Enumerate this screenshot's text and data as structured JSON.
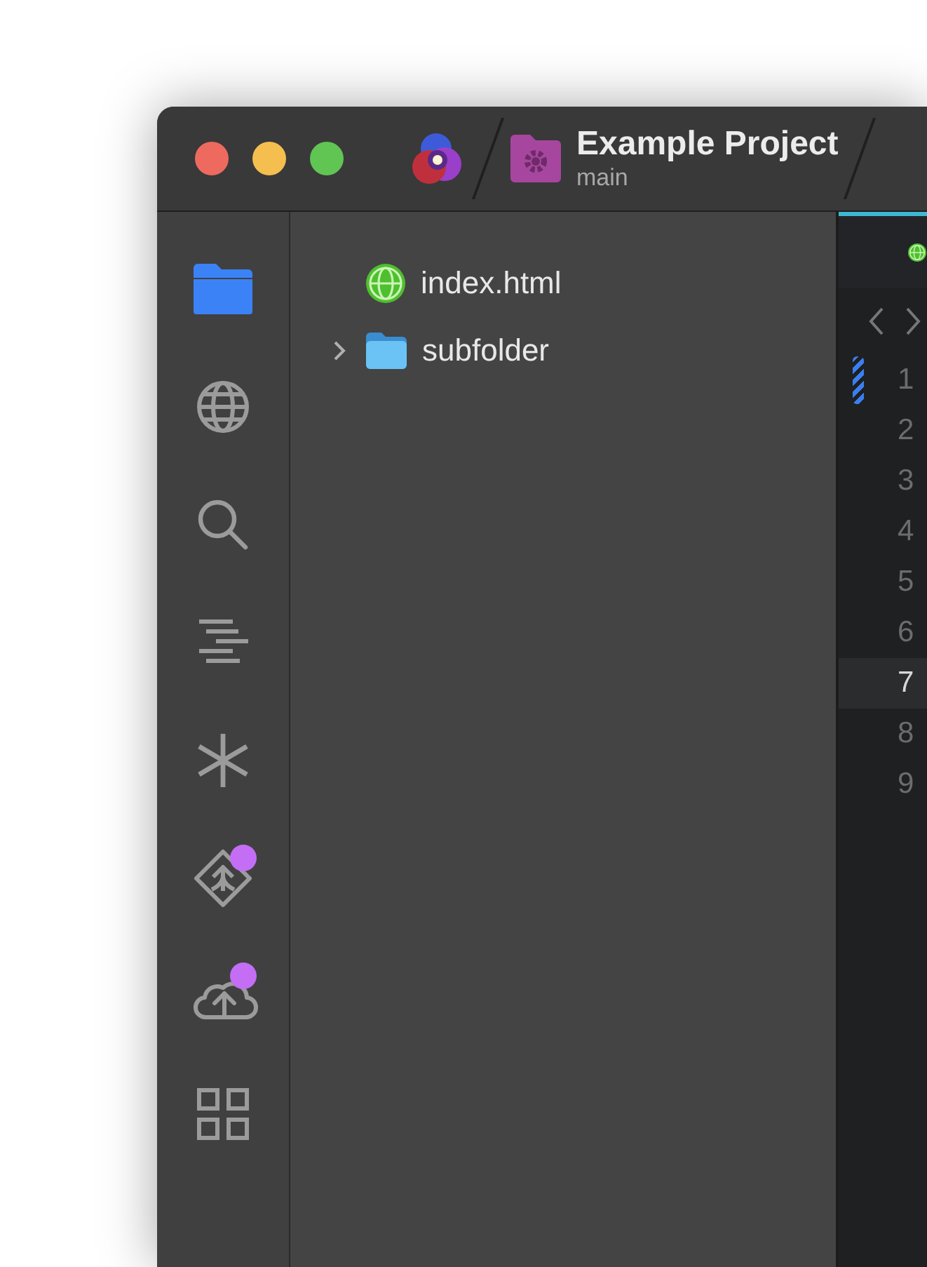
{
  "window": {
    "title": "Example Project",
    "branch": "main"
  },
  "traffic_lights": [
    {
      "color": "#ee6a5f"
    },
    {
      "color": "#f5bf4f"
    },
    {
      "color": "#61c554"
    }
  ],
  "activity_bar": [
    {
      "kind": "folder",
      "selected": true,
      "badge": false
    },
    {
      "kind": "globe",
      "selected": false,
      "badge": false
    },
    {
      "kind": "search",
      "selected": false,
      "badge": false
    },
    {
      "kind": "outline",
      "selected": false,
      "badge": false
    },
    {
      "kind": "asterisk",
      "selected": false,
      "badge": false
    },
    {
      "kind": "source-control",
      "selected": false,
      "badge": true
    },
    {
      "kind": "cloud",
      "selected": false,
      "badge": true
    },
    {
      "kind": "grid",
      "selected": false,
      "badge": false
    }
  ],
  "file_tree": [
    {
      "kind": "file",
      "name": "index.html"
    },
    {
      "kind": "folder",
      "name": "subfolder",
      "expanded": false
    }
  ],
  "editor": {
    "lines": [
      {
        "number": "1",
        "modified": true,
        "selected": false
      },
      {
        "number": "2",
        "modified": false,
        "selected": false
      },
      {
        "number": "3",
        "modified": false,
        "selected": false
      },
      {
        "number": "4",
        "modified": false,
        "selected": false
      },
      {
        "number": "5",
        "modified": false,
        "selected": false
      },
      {
        "number": "6",
        "modified": false,
        "selected": false
      },
      {
        "number": "7",
        "modified": false,
        "selected": true
      },
      {
        "number": "8",
        "modified": false,
        "selected": false
      },
      {
        "number": "9",
        "modified": false,
        "selected": false
      }
    ]
  }
}
